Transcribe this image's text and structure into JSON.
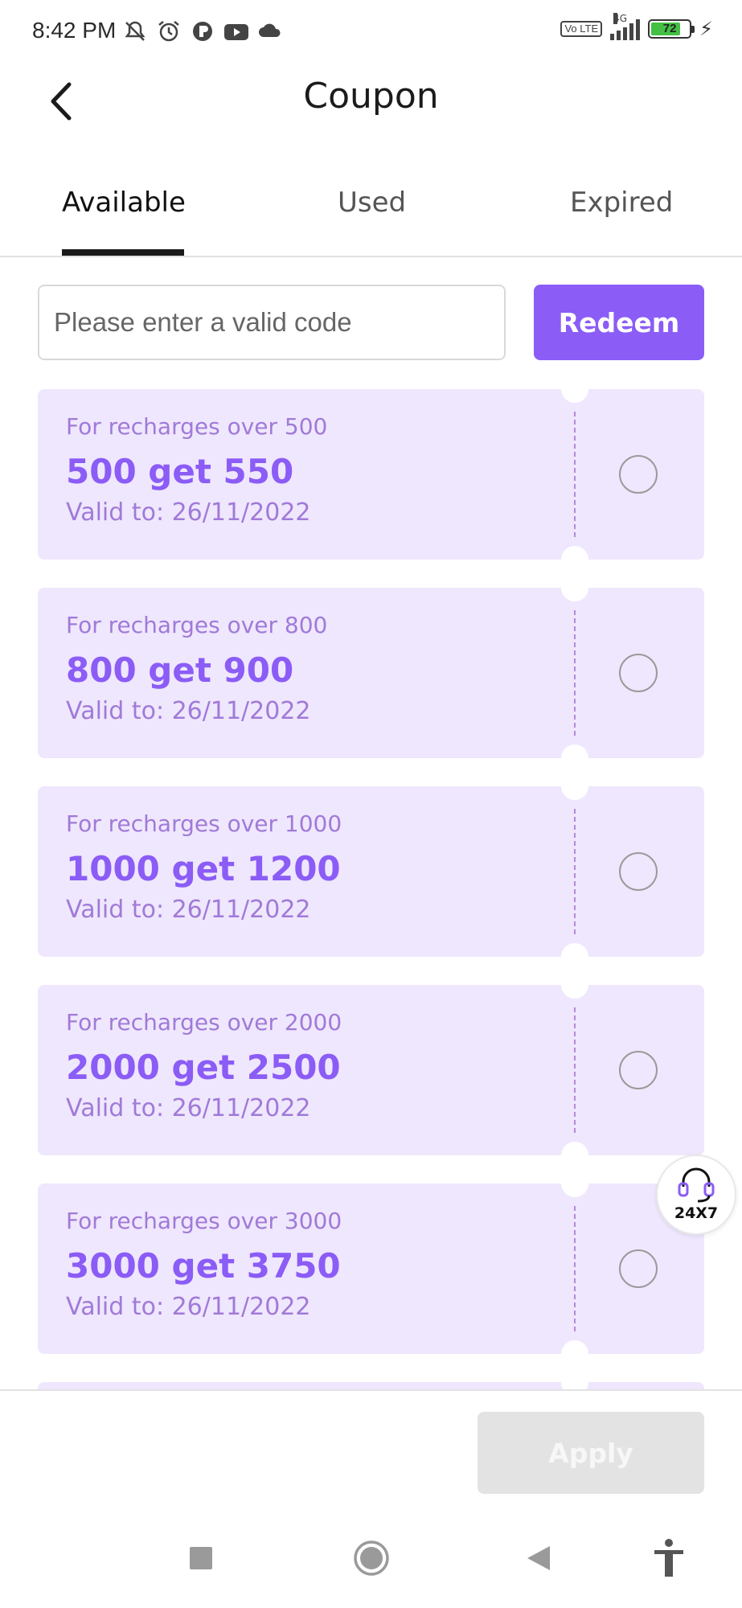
{
  "status_bar": {
    "time": "8:42 PM",
    "left_icons": [
      "mute-icon",
      "alarm-icon",
      "app-icon",
      "youtube-icon",
      "cloud-icon"
    ],
    "network": "4G",
    "volte": "Vo LTE",
    "battery_percent": "72"
  },
  "header": {
    "title": "Coupon"
  },
  "tabs": [
    {
      "label": "Available",
      "active": true
    },
    {
      "label": "Used",
      "active": false
    },
    {
      "label": "Expired",
      "active": false
    }
  ],
  "code_input": {
    "placeholder": "Please enter a valid code",
    "value": ""
  },
  "redeem_label": "Redeem",
  "coupons": [
    {
      "condition": "For recharges over 500",
      "title": "500 get 550",
      "valid": "Valid to: 26/11/2022",
      "selected": false
    },
    {
      "condition": "For recharges over 800",
      "title": "800 get 900",
      "valid": "Valid to: 26/11/2022",
      "selected": false
    },
    {
      "condition": "For recharges over 1000",
      "title": "1000 get 1200",
      "valid": "Valid to: 26/11/2022",
      "selected": false
    },
    {
      "condition": "For recharges over 2000",
      "title": "2000 get 2500",
      "valid": "Valid to: 26/11/2022",
      "selected": false
    },
    {
      "condition": "For recharges over 3000",
      "title": "3000 get 3750",
      "valid": "Valid to: 26/11/2022",
      "selected": false
    }
  ],
  "support_label": "24X7",
  "apply_label": "Apply",
  "colors": {
    "accent": "#8b5cf6",
    "coupon_bg": "#efe7fd",
    "coupon_text": "#a07ad8",
    "apply_disabled": "#e3e3e3"
  }
}
